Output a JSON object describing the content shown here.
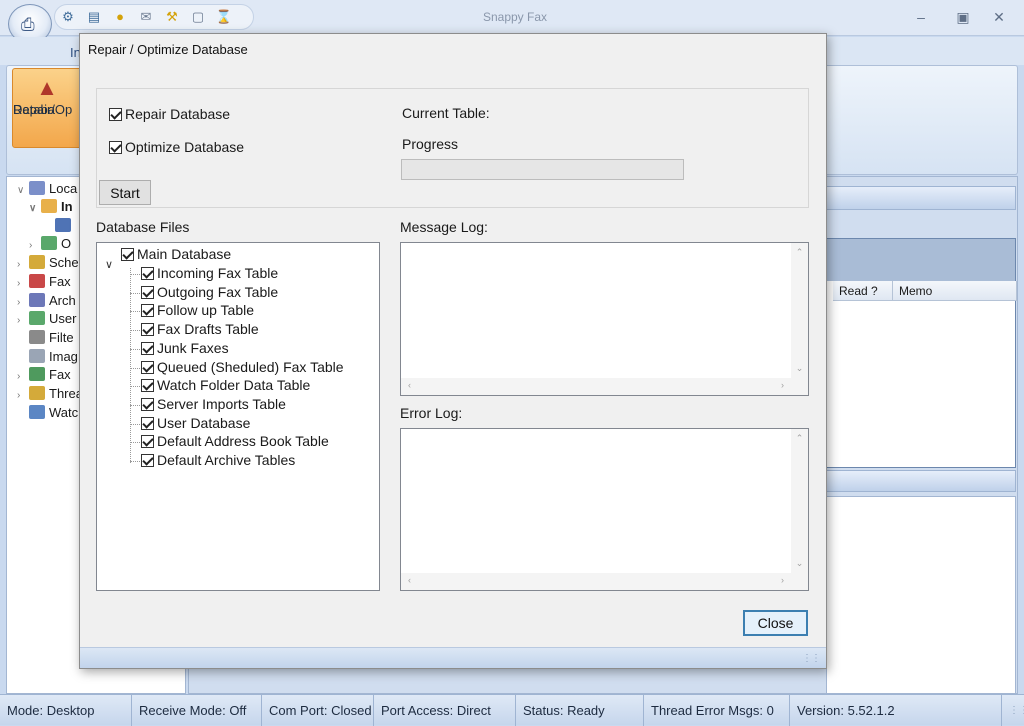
{
  "app": {
    "title": "Snappy Fax",
    "ribbon_tab": "In",
    "big_button_label_1": "Repair/Op",
    "big_button_label_2": "Databa",
    "window_controls": [
      "minimize-icon",
      "maximize-icon",
      "close-icon"
    ]
  },
  "nav": {
    "items": [
      {
        "label": "Loca",
        "icon": "database-icon"
      },
      {
        "label": "In",
        "icon": "inbox-icon"
      },
      {
        "label": "O",
        "icon": "outbox-icon"
      },
      {
        "label": "Sche",
        "icon": "calendar-icon"
      },
      {
        "label": "Fax",
        "icon": "fax-icon"
      },
      {
        "label": "Arch",
        "icon": "archive-icon"
      },
      {
        "label": "User",
        "icon": "user-icon"
      },
      {
        "label": "Filte",
        "icon": "filter-icon"
      },
      {
        "label": "Imag",
        "icon": "image-icon"
      },
      {
        "label": "Fax",
        "icon": "fax-folder-icon"
      },
      {
        "label": "Threa",
        "icon": "thread-icon"
      },
      {
        "label": "Watc",
        "icon": "watch-folder-icon"
      }
    ]
  },
  "grid": {
    "columns": [
      "Read ?",
      "Memo"
    ]
  },
  "dialog": {
    "title": "Repair / Optimize Database",
    "repair_label": "Repair Database",
    "optimize_label": "Optimize Database",
    "current_table_label": "Current Table:",
    "progress_label": "Progress",
    "progress_value": 0,
    "start_button": "Start",
    "db_files_label": "Database Files",
    "root_node": "Main Database",
    "tables": [
      "Incoming Fax Table",
      "Outgoing Fax Table",
      "Follow up Table",
      "Fax Drafts Table",
      "Junk Faxes",
      "Queued (Sheduled) Fax Table",
      "Watch Folder Data Table",
      "Server Imports Table",
      "User Database",
      "Default Address Book Table",
      "Default Archive Tables"
    ],
    "message_log_label": "Message Log:",
    "error_log_label": "Error Log:",
    "close_button": "Close"
  },
  "status": {
    "mode": "Mode: Desktop",
    "receive_mode": "Receive Mode: Off",
    "com_port": "Com Port: Closed",
    "port_access": "Port Access: Direct",
    "status": "Status: Ready",
    "thread_errors": "Thread Error Msgs: 0",
    "version": "Version: 5.52.1.2"
  }
}
